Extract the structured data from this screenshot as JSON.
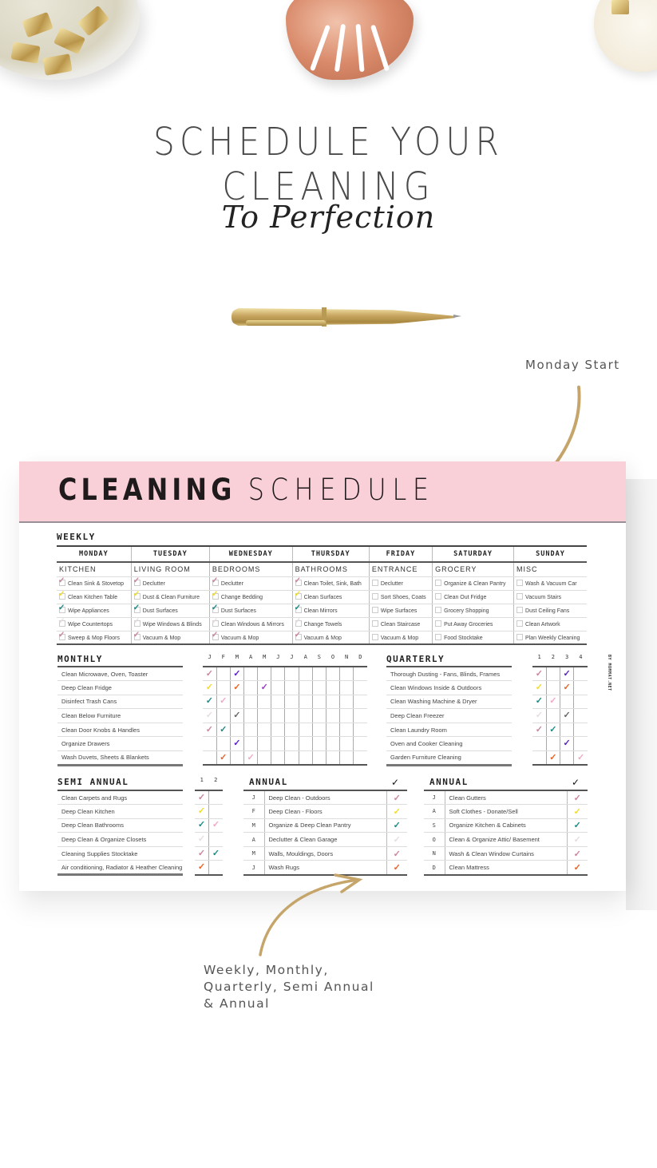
{
  "hero": {
    "headline": "SCHEDULE YOUR CLEANING",
    "subline": "To Perfection"
  },
  "callouts": {
    "top": "Monday Start",
    "bottom_lines": [
      "Weekly, Monthly,",
      "Quarterly, Semi Annual",
      "& Annual"
    ]
  },
  "colors": {
    "banner": "#f9cfd8",
    "check_mauve": "#c9869c",
    "check_yellow": "#f1dc2a",
    "check_teal": "#1e8a86",
    "check_light": "#e6dce3",
    "check_purple": "#5a1fc4",
    "check_orange": "#e7642a",
    "check_violet": "#9b3ec8",
    "check_pink": "#f0a8c6",
    "check_gray": "#666666"
  },
  "sheet": {
    "title_bold": "CLEANING",
    "title_light": "SCHEDULE",
    "credit": "BY MOMMAT.NET",
    "weekly": {
      "label": "WEEKLY",
      "days": [
        "MONDAY",
        "TUESDAY",
        "WEDNESDAY",
        "THURSDAY",
        "FRIDAY",
        "SATURDAY",
        "SUNDAY"
      ],
      "areas": [
        "KITCHEN",
        "LIVING ROOM",
        "BEDROOMS",
        "BATHROOMS",
        "ENTRANCE",
        "GROCERY",
        "MISC"
      ],
      "rows": [
        [
          "Clean Sink & Stovetop",
          "Declutter",
          "Declutter",
          "Clean Toilet, Sink, Bath",
          "Declutter",
          "Organize & Clean Pantry",
          "Wash & Vacuum Car"
        ],
        [
          "Clean Kitchen Table",
          "Dust & Clean Furniture",
          "Change Bedding",
          "Clean Surfaces",
          "Sort Shoes, Coats",
          "Clean Out Fridge",
          "Vacuum Stairs"
        ],
        [
          "Wipe Appliances",
          "Dust Surfaces",
          "Dust Surfaces",
          "Clean Mirrors",
          "Wipe Surfaces",
          "Grocery Shopping",
          "Dust Ceiling Fans"
        ],
        [
          "Wipe Countertops",
          "Wipe Windows & Blinds",
          "Clean Windows & Mirrors",
          "Change Towels",
          "Clean Staircase",
          "Put Away Groceries",
          "Clean Artwork"
        ],
        [
          "Sweep & Mop Floors",
          "Vacuum & Mop",
          "Vacuum & Mop",
          "Vacuum & Mop",
          "Vacuum & Mop",
          "Food Stocktake",
          "Plan Weekly Cleaning"
        ]
      ],
      "row_check_colors": [
        "check_mauve",
        "check_yellow",
        "check_teal",
        "check_light",
        "check_mauve"
      ],
      "checked_days": 4
    },
    "monthly": {
      "label": "MONTHLY",
      "months": [
        "J",
        "F",
        "M",
        "A",
        "M",
        "J",
        "J",
        "A",
        "S",
        "O",
        "N",
        "D"
      ],
      "tasks": [
        "Clean Microwave, Oven, Toaster",
        "Deep Clean Fridge",
        "Disinfect Trash Cans",
        "Clean Below Furniture",
        "Clean Door Knobs & Handles",
        "Organize Drawers",
        "Wash Duvets, Sheets & Blankets"
      ],
      "checks": [
        [
          [
            0,
            "check_mauve"
          ],
          [
            2,
            "check_purple"
          ]
        ],
        [
          [
            0,
            "check_yellow"
          ],
          [
            2,
            "check_orange"
          ],
          [
            4,
            "check_violet"
          ]
        ],
        [
          [
            0,
            "check_teal"
          ],
          [
            1,
            "check_pink"
          ]
        ],
        [
          [
            0,
            "check_light"
          ],
          [
            2,
            "check_gray"
          ]
        ],
        [
          [
            0,
            "check_mauve"
          ],
          [
            1,
            "check_teal"
          ]
        ],
        [
          [
            2,
            "check_purple"
          ]
        ],
        [
          [
            1,
            "check_orange"
          ],
          [
            3,
            "check_pink"
          ]
        ]
      ]
    },
    "quarterly": {
      "label": "QUARTERLY",
      "quarters": [
        "1",
        "2",
        "3",
        "4"
      ],
      "tasks": [
        "Thorough Dusting - Fans, Blinds, Frames",
        "Clean Windows Inside & Outdoors",
        "Clean Washing Machine & Dryer",
        "Deep Clean Freezer",
        "Clean Laundry Room",
        "Oven and Cooker Cleaning",
        "Garden Furniture Cleaning"
      ],
      "checks": [
        [
          [
            0,
            "check_mauve"
          ],
          [
            2,
            "check_purple"
          ]
        ],
        [
          [
            0,
            "check_yellow"
          ],
          [
            2,
            "check_orange"
          ]
        ],
        [
          [
            0,
            "check_teal"
          ],
          [
            1,
            "check_pink"
          ]
        ],
        [
          [
            0,
            "check_light"
          ],
          [
            2,
            "check_gray"
          ]
        ],
        [
          [
            0,
            "check_mauve"
          ],
          [
            1,
            "check_teal"
          ]
        ],
        [
          [
            2,
            "check_purple"
          ]
        ],
        [
          [
            1,
            "check_orange"
          ],
          [
            3,
            "check_pink"
          ]
        ]
      ]
    },
    "semi_annual": {
      "label": "SEMI ANNUAL",
      "halves": [
        "1",
        "2"
      ],
      "tasks": [
        "Clean Carpets and Rugs",
        "Deep Clean Kitchen",
        "Deep Clean Bathrooms",
        "Deep Clean & Organize Closets",
        "Cleaning Supplies Stocktake",
        "Air conditioning, Radiator & Heather Cleaning"
      ],
      "checks": [
        [
          [
            0,
            "check_mauve"
          ]
        ],
        [
          [
            0,
            "check_yellow"
          ]
        ],
        [
          [
            0,
            "check_teal"
          ],
          [
            1,
            "check_pink"
          ]
        ],
        [
          [
            0,
            "check_light"
          ]
        ],
        [
          [
            0,
            "check_mauve"
          ],
          [
            1,
            "check_teal"
          ]
        ],
        [
          [
            0,
            "check_orange"
          ]
        ]
      ]
    },
    "annual_1": {
      "label": "ANNUAL",
      "check_header": "✓",
      "rows": [
        {
          "month": "J",
          "task": "Deep Clean - Outdoors",
          "color": "check_mauve"
        },
        {
          "month": "F",
          "task": "Deep Clean - Floors",
          "color": "check_yellow"
        },
        {
          "month": "M",
          "task": "Organize & Deep Clean Pantry",
          "color": "check_teal"
        },
        {
          "month": "A",
          "task": "Declutter & Clean Garage",
          "color": "check_light"
        },
        {
          "month": "M",
          "task": "Walls, Mouldings, Doors",
          "color": "check_mauve"
        },
        {
          "month": "J",
          "task": "Wash Rugs",
          "color": "check_orange"
        }
      ]
    },
    "annual_2": {
      "label": "ANNUAL",
      "check_header": "✓",
      "rows": [
        {
          "month": "J",
          "task": "Clean Gutters",
          "color": "check_mauve"
        },
        {
          "month": "A",
          "task": "Soft Clothes - Donate/Sell",
          "color": "check_yellow"
        },
        {
          "month": "S",
          "task": "Organize Kitchen & Cabinets",
          "color": "check_teal"
        },
        {
          "month": "O",
          "task": "Clean & Organize Attic/ Basement",
          "color": "check_light"
        },
        {
          "month": "N",
          "task": "Wash & Clean Window Curtains",
          "color": "check_mauve"
        },
        {
          "month": "D",
          "task": "Clean Mattress",
          "color": "check_orange"
        }
      ]
    }
  }
}
